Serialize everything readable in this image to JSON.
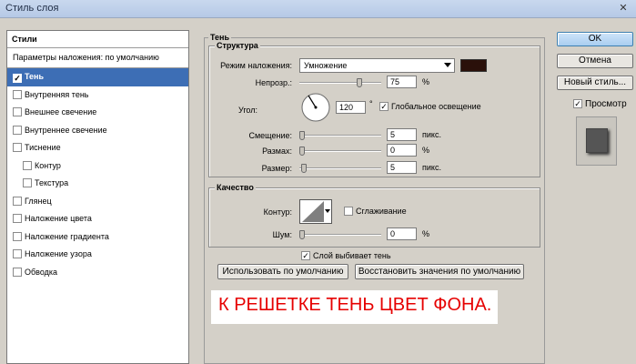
{
  "window": {
    "title": "Стиль слоя"
  },
  "styles_panel": {
    "header": "Стили",
    "blend_defaults": "Параметры наложения: по умолчанию",
    "items": [
      {
        "label": "Тень",
        "checked": true,
        "selected": true,
        "indent": false
      },
      {
        "label": "Внутренняя тень",
        "checked": false,
        "indent": false
      },
      {
        "label": "Внешнее свечение",
        "checked": false,
        "indent": false
      },
      {
        "label": "Внутреннее свечение",
        "checked": false,
        "indent": false
      },
      {
        "label": "Тиснение",
        "checked": false,
        "indent": false
      },
      {
        "label": "Контур",
        "checked": false,
        "indent": true
      },
      {
        "label": "Текстура",
        "checked": false,
        "indent": true
      },
      {
        "label": "Глянец",
        "checked": false,
        "indent": false
      },
      {
        "label": "Наложение цвета",
        "checked": false,
        "indent": false
      },
      {
        "label": "Наложение градиента",
        "checked": false,
        "indent": false
      },
      {
        "label": "Наложение узора",
        "checked": false,
        "indent": false
      },
      {
        "label": "Обводка",
        "checked": false,
        "indent": false
      }
    ]
  },
  "shadow": {
    "title": "Тень",
    "structure": {
      "title": "Структура",
      "blend_mode_label": "Режим наложения:",
      "blend_mode_value": "Умножение",
      "shadow_color": "#2a100a",
      "opacity_label": "Непрозр.:",
      "opacity_value": "75",
      "opacity_unit": "%",
      "opacity_fraction": 0.75,
      "angle_label": "Угол:",
      "angle_value": "120",
      "angle_unit": "°",
      "global_light_label": "Глобальное освещение",
      "global_light_checked": true,
      "distance_label": "Смещение:",
      "distance_value": "5",
      "distance_unit": "пикс.",
      "spread_label": "Размах:",
      "spread_value": "0",
      "spread_unit": "%",
      "size_label": "Размер:",
      "size_value": "5",
      "size_unit": "пикс."
    },
    "quality": {
      "title": "Качество",
      "contour_label": "Контур:",
      "antialias_label": "Сглаживание",
      "antialias_checked": false,
      "noise_label": "Шум:",
      "noise_value": "0",
      "noise_unit": "%"
    },
    "layer_knocks_out_label": "Слой выбивает тень",
    "layer_knocks_out_checked": true,
    "use_default_label": "Использовать по умолчанию",
    "restore_default_label": "Восстановить значения по умолчанию"
  },
  "buttons": {
    "ok": "OK",
    "cancel": "Отмена",
    "new_style": "Новый стиль...",
    "preview_label": "Просмотр",
    "preview_checked": true
  },
  "annotation": "К РЕШЕТКЕ ТЕНЬ ЦВЕТ ФОНА."
}
